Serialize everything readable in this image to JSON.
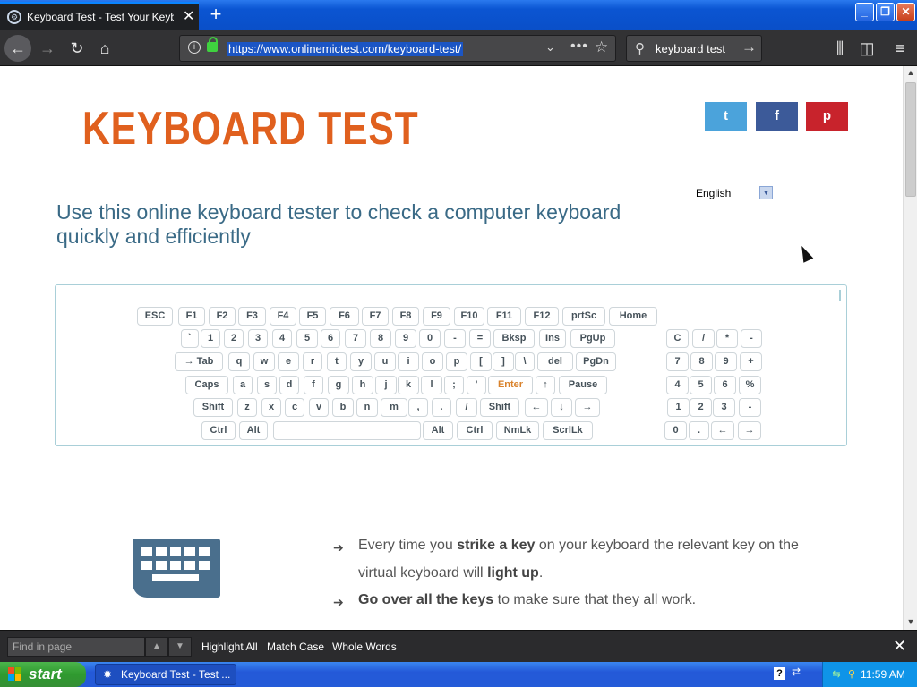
{
  "browser": {
    "tab_title": "Keyboard Test - Test Your Keyboard",
    "tab_close": "✕",
    "new_tab": "+",
    "url": "https://www.onlinemictest.com/keyboard-test/",
    "search_text": "keyboard test",
    "window_buttons": {
      "minimize": "_",
      "maximize": "❐",
      "close": "✕"
    }
  },
  "page": {
    "logo": "KEYBOARD TEST",
    "social": {
      "twitter": "t",
      "facebook": "f",
      "pinterest": "p"
    },
    "language": "English",
    "tagline": "Use this online keyboard tester to check a computer keyboard quickly and efficiently",
    "keyboard_rows": [
      [
        "ESC",
        "F1",
        "F2",
        "F3",
        "F4",
        "F5",
        "F6",
        "F7",
        "F8",
        "F9",
        "F10",
        "F11",
        "F12",
        "prtSc",
        "Home"
      ],
      [
        "`",
        "1",
        "2",
        "3",
        "4",
        "5",
        "6",
        "7",
        "8",
        "9",
        "0",
        "-",
        "=",
        "Bksp",
        "Ins",
        "PgUp",
        "C",
        "/",
        "*",
        "-"
      ],
      [
        "→ Tab",
        "q",
        "w",
        "e",
        "r",
        "t",
        "y",
        "u",
        "i",
        "o",
        "p",
        "[",
        "]",
        "\\",
        "del",
        "PgDn",
        "7",
        "8",
        "9",
        "+"
      ],
      [
        "Caps",
        "a",
        "s",
        "d",
        "f",
        "g",
        "h",
        "j",
        "k",
        "l",
        ";",
        "'",
        "Enter",
        "↑",
        "Pause",
        "4",
        "5",
        "6",
        "%"
      ],
      [
        "Shift",
        "z",
        "x",
        "c",
        "v",
        "b",
        "n",
        "m",
        ",",
        ".",
        "/",
        "Shift",
        "←",
        "↓",
        "→",
        "1",
        "2",
        "3",
        "-"
      ],
      [
        "Ctrl",
        "Alt",
        "",
        "Alt",
        "Ctrl",
        "NmLk",
        "ScrlLk",
        "0",
        ".",
        "←",
        "→"
      ]
    ],
    "features": [
      {
        "pre": "Every time you ",
        "bold": "strike a key",
        "post": " on your keyboard the relevant key on the"
      },
      {
        "pre": "virtual keyboard will ",
        "bold": "light up",
        "post": "."
      },
      {
        "pre": "",
        "bold": "Go over all the keys",
        "post": " to make sure that they all work."
      }
    ]
  },
  "findbar": {
    "placeholder": "Find in page",
    "highlight_all": "Highlight All",
    "match_case": "Match Case",
    "whole_words": "Whole Words"
  },
  "taskbar": {
    "start": "start",
    "task_item": "Keyboard Test - Test ...",
    "clock": "11:59 AM"
  },
  "colors": {
    "accent": "#e0601e",
    "tagline": "#3a6a86",
    "twitter": "#4ba3db",
    "facebook": "#3c5a99",
    "pinterest": "#c8232c"
  }
}
